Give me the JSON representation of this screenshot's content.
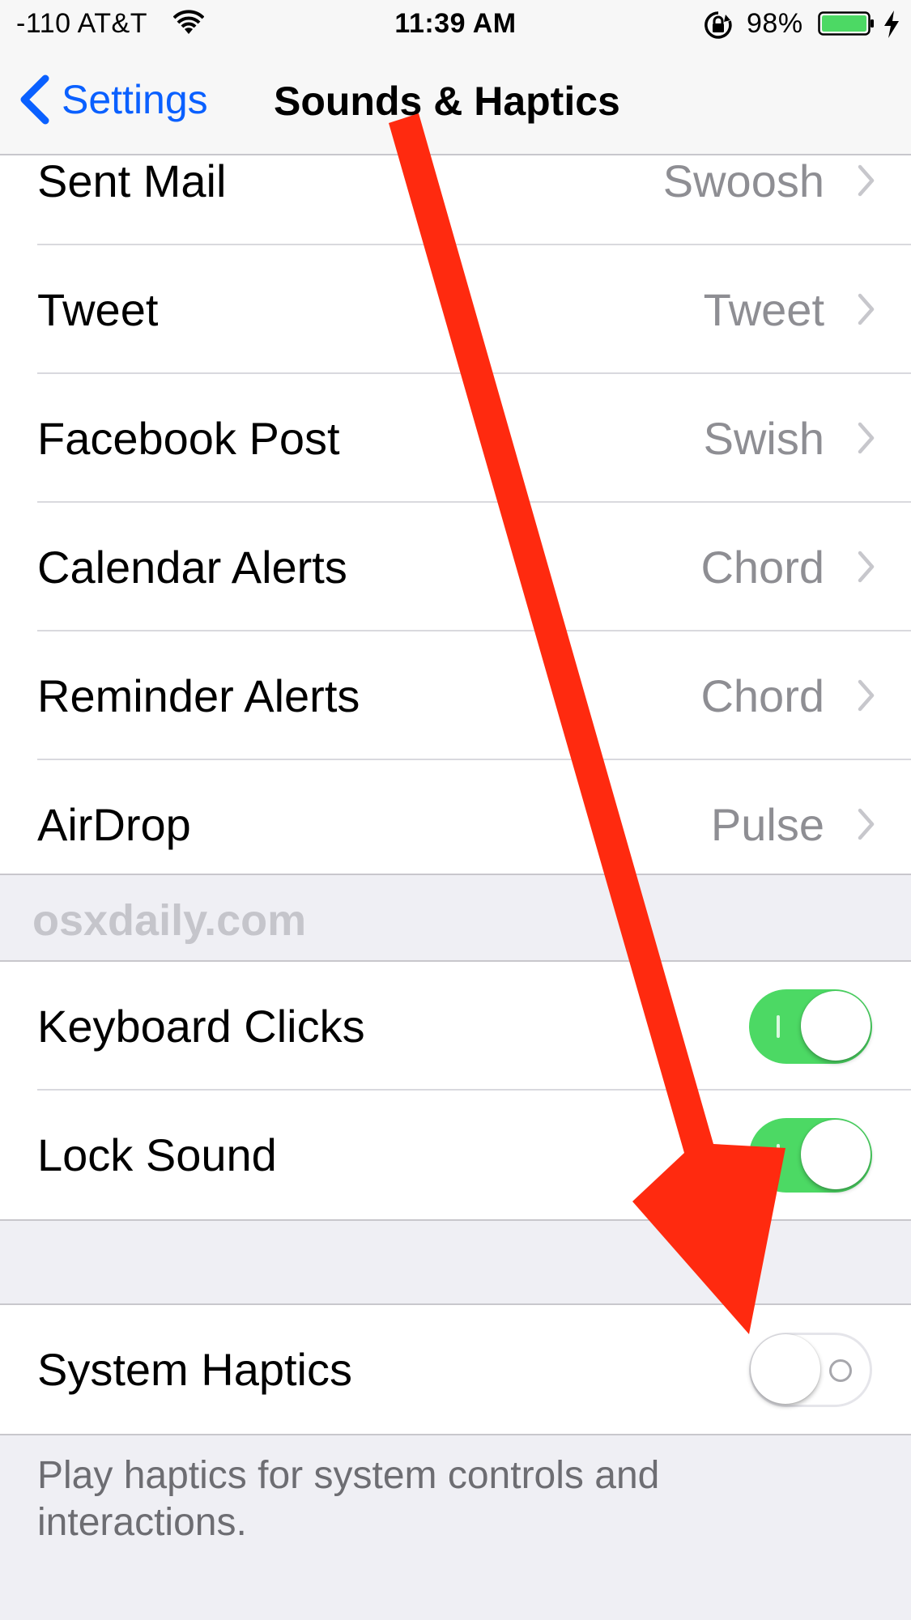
{
  "status_bar": {
    "carrier": "-110 AT&T",
    "time": "11:39 AM",
    "battery_percent": "98%",
    "battery_color": "#4cd964"
  },
  "nav": {
    "back_label": "Settings",
    "title": "Sounds & Haptics",
    "accent_color": "#0a60ff"
  },
  "sound_rows": [
    {
      "label": "Sent Mail",
      "value": "Swoosh"
    },
    {
      "label": "Tweet",
      "value": "Tweet"
    },
    {
      "label": "Facebook Post",
      "value": "Swish"
    },
    {
      "label": "Calendar Alerts",
      "value": "Chord"
    },
    {
      "label": "Reminder Alerts",
      "value": "Chord"
    },
    {
      "label": "AirDrop",
      "value": "Pulse"
    }
  ],
  "watermark": "osxdaily.com",
  "toggle_rows": [
    {
      "label": "Keyboard Clicks",
      "on": true
    },
    {
      "label": "Lock Sound",
      "on": true
    }
  ],
  "haptics": {
    "label": "System Haptics",
    "on": false,
    "footer": "Play haptics for system controls and interactions."
  },
  "annotation": {
    "arrow_color": "#ff2a0f"
  }
}
